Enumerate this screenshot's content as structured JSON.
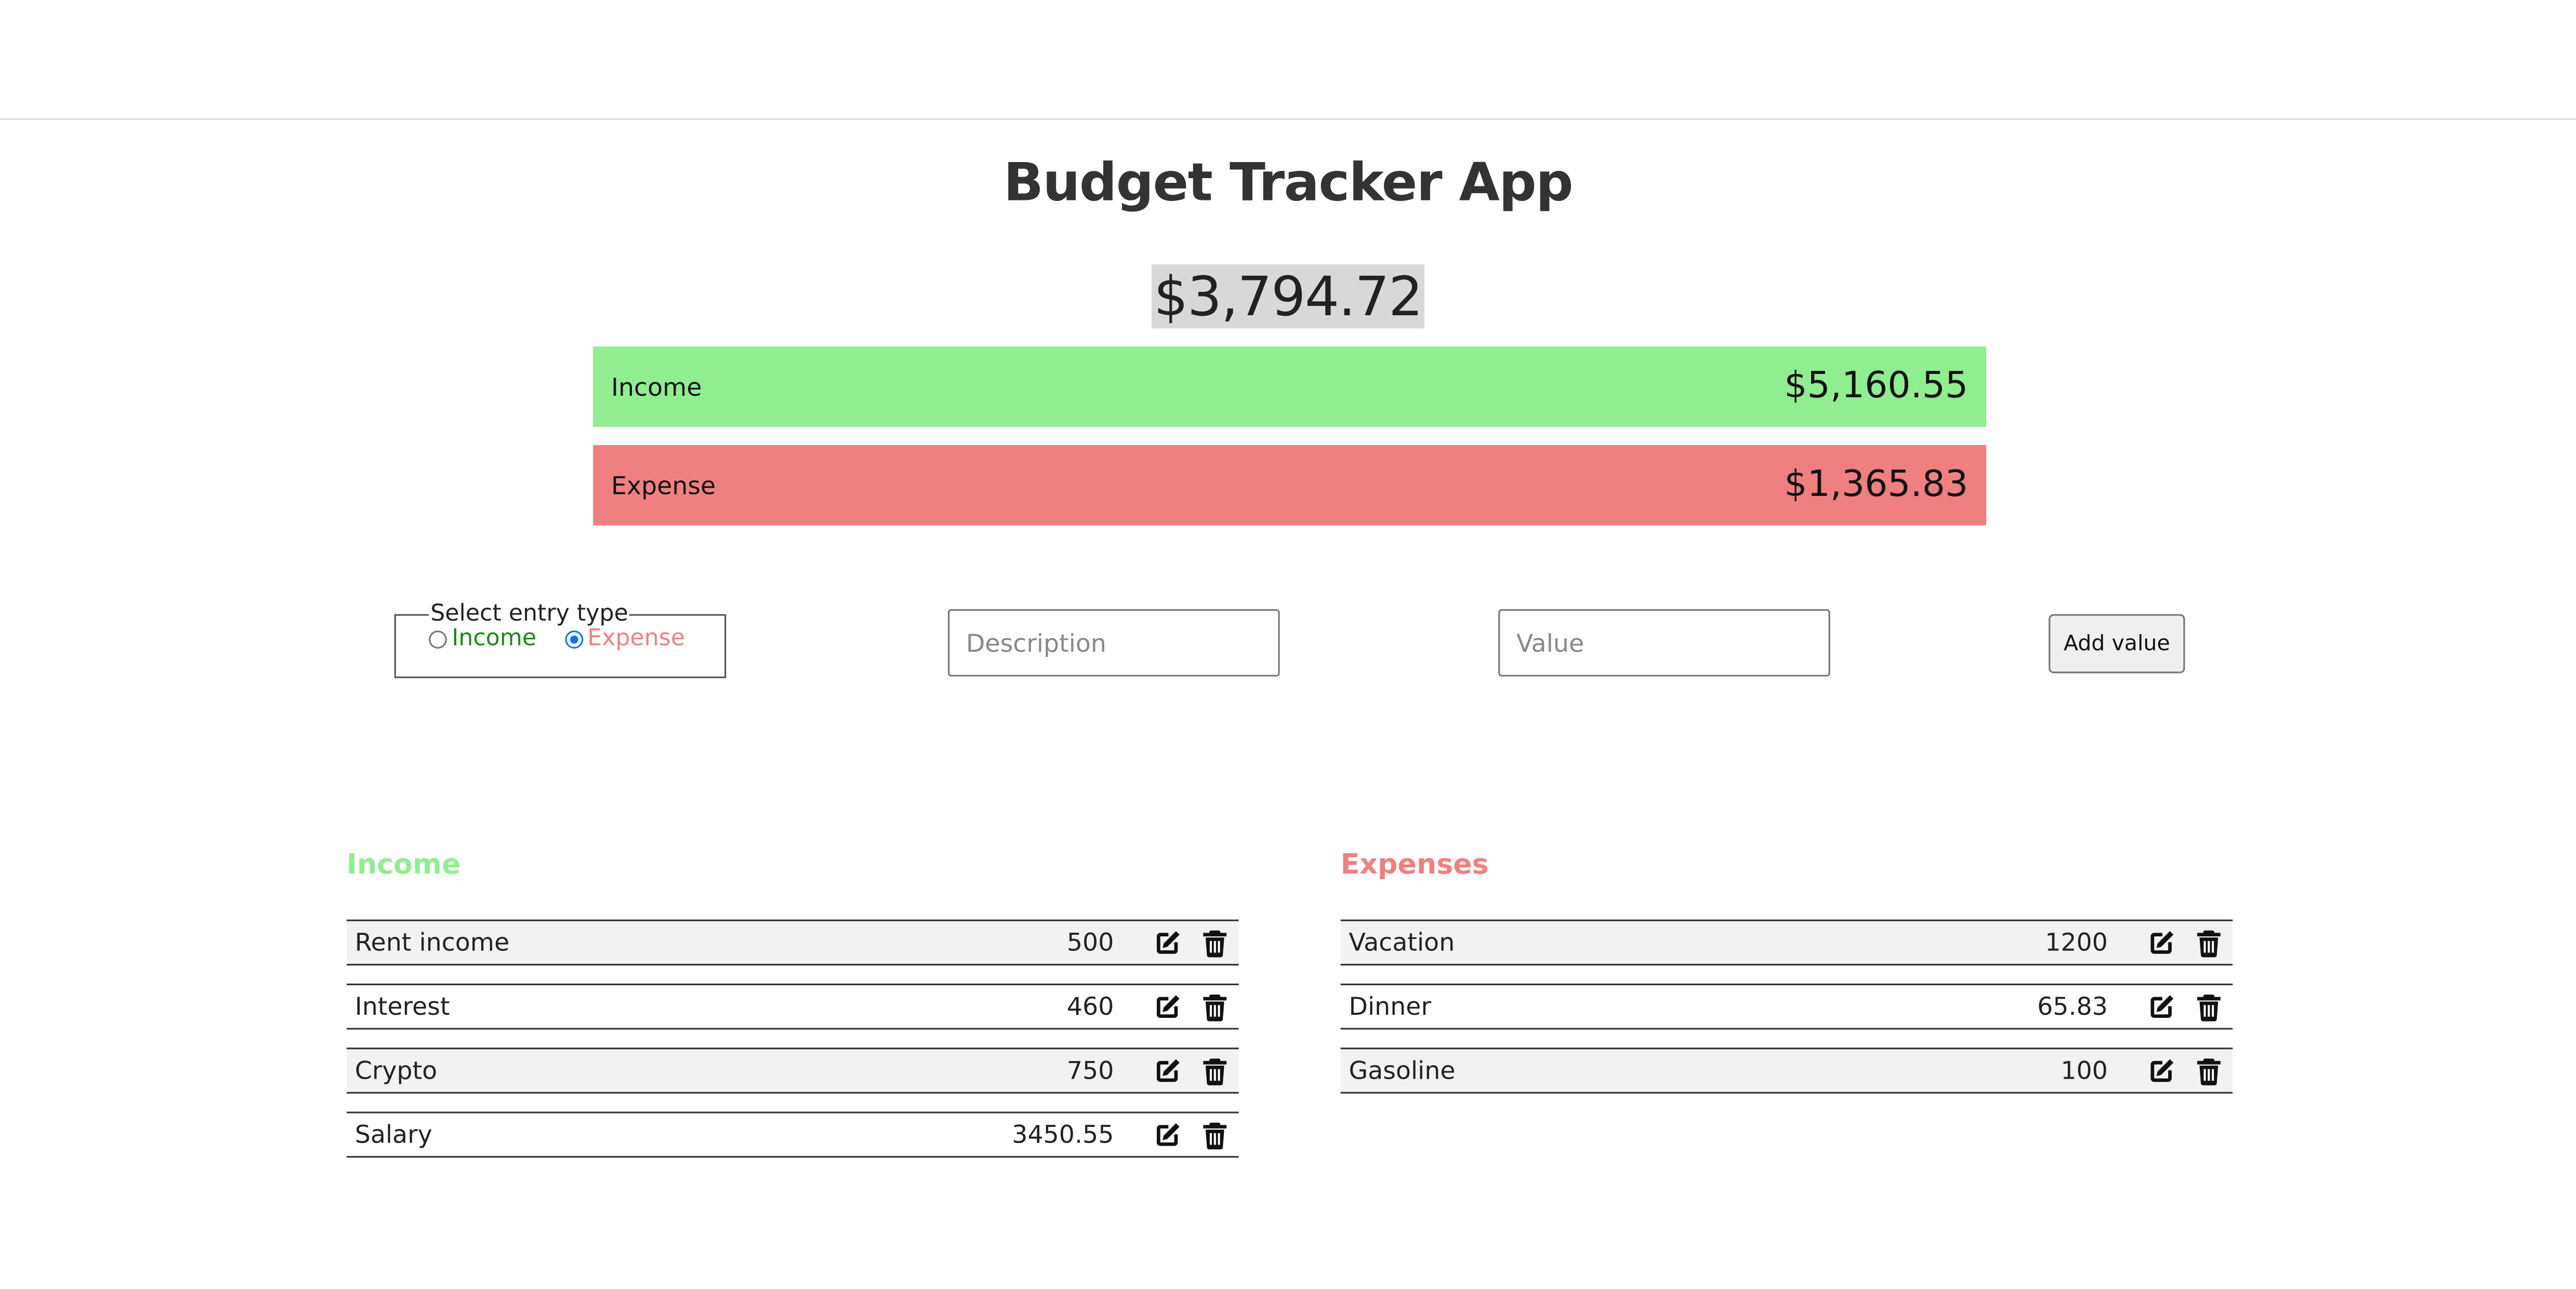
{
  "app": {
    "title": "Budget Tracker App",
    "balance": "$3,794.72"
  },
  "summary": {
    "income_label": "Income",
    "income_value": "$5,160.55",
    "expense_label": "Expense",
    "expense_value": "$1,365.83"
  },
  "form": {
    "legend": "Select entry type",
    "options": [
      {
        "label": "Income",
        "checked": false
      },
      {
        "label": "Expense",
        "checked": true
      }
    ],
    "description_placeholder": "Description",
    "value_placeholder": "Value",
    "add_button_label": "Add value"
  },
  "income_list": {
    "heading": "Income",
    "entries": [
      {
        "description": "Rent income",
        "value": "500"
      },
      {
        "description": "Interest",
        "value": "460"
      },
      {
        "description": "Crypto",
        "value": "750"
      },
      {
        "description": "Salary",
        "value": "3450.55"
      }
    ]
  },
  "expense_list": {
    "heading": "Expenses",
    "entries": [
      {
        "description": "Vacation",
        "value": "1200"
      },
      {
        "description": "Dinner",
        "value": "65.83"
      },
      {
        "description": "Gasoline",
        "value": "100"
      }
    ]
  },
  "icons": {
    "edit": "edit-icon",
    "delete": "trash-icon"
  },
  "colors": {
    "income_green": "#90ee90",
    "expense_red": "#f08080",
    "balance_highlight": "#d8d8d8"
  }
}
